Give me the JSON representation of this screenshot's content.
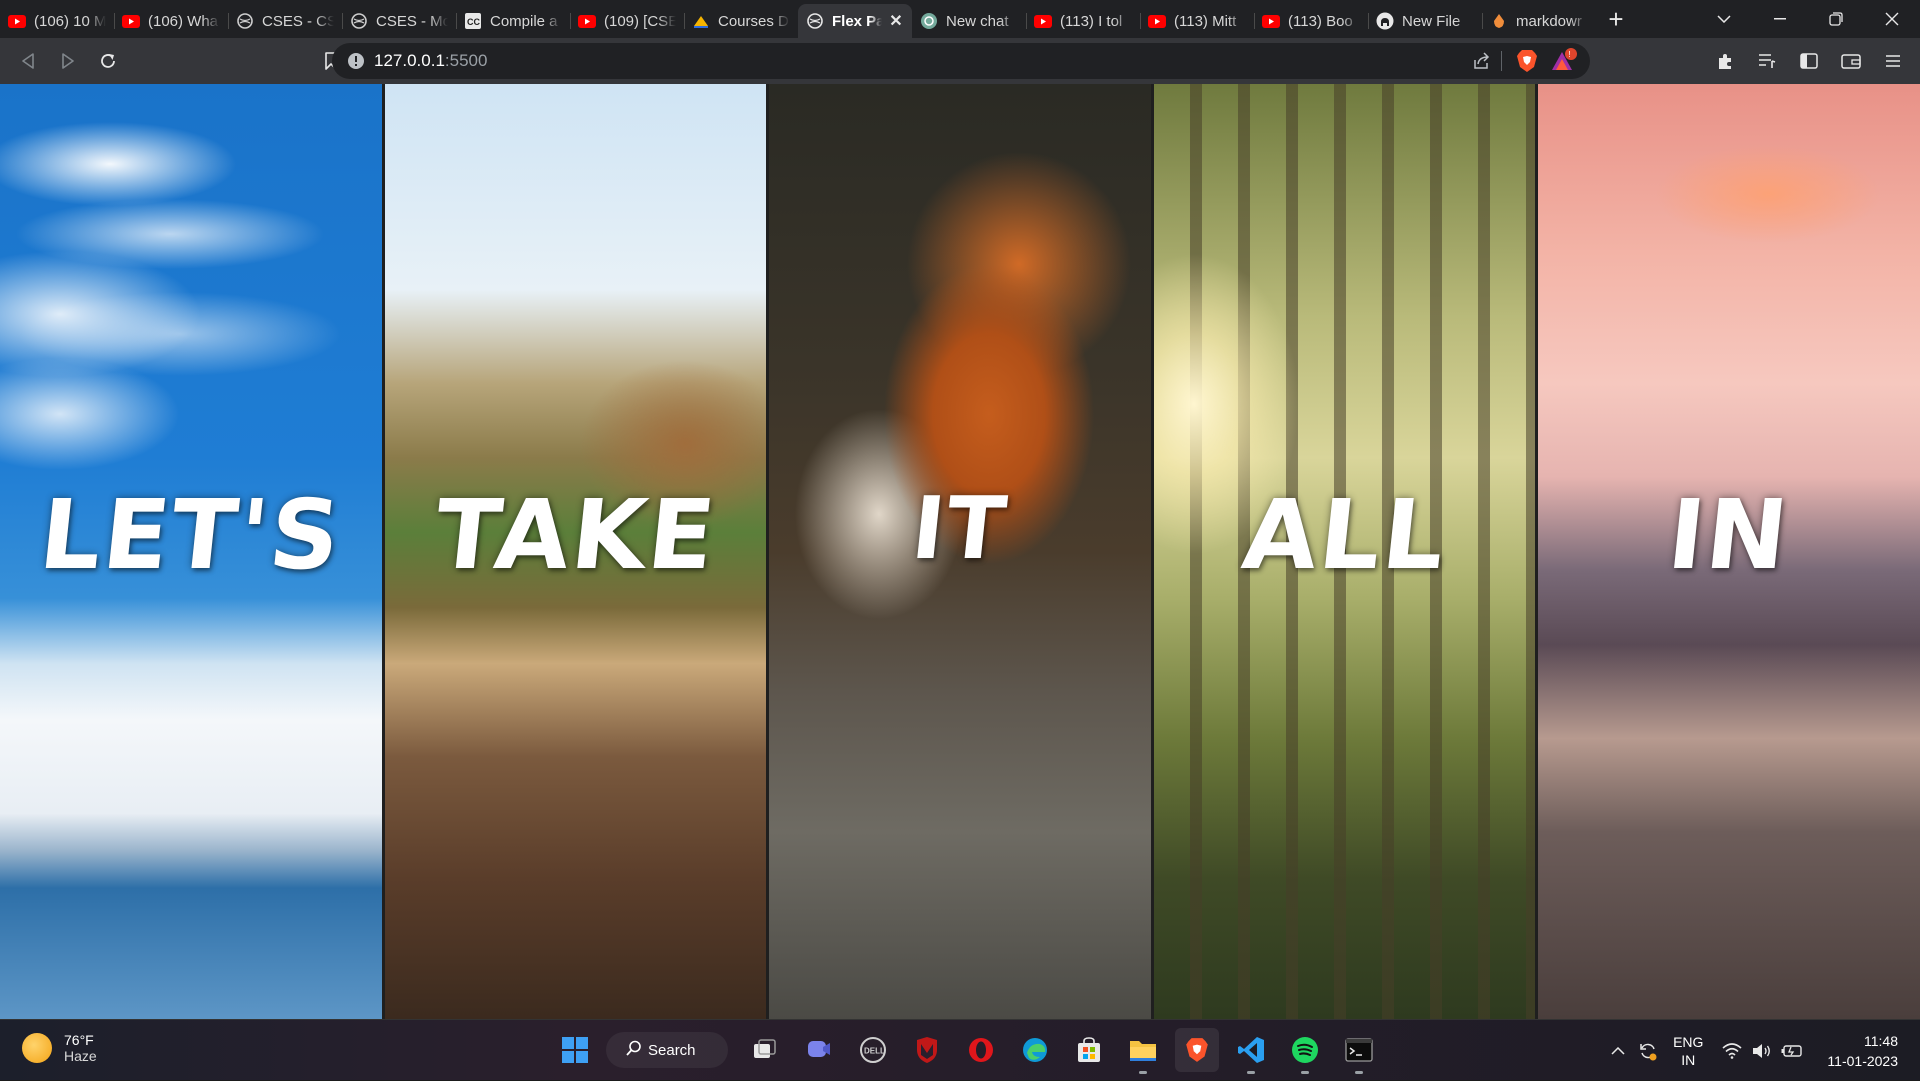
{
  "browser": {
    "tabs": [
      {
        "title": "(106) 10 M",
        "icon": "youtube-icon"
      },
      {
        "title": "(106) Wha",
        "icon": "youtube-icon"
      },
      {
        "title": "CSES - CSI",
        "icon": "globe-icon"
      },
      {
        "title": "CSES - Mo",
        "icon": "globe-icon"
      },
      {
        "title": "Compile a",
        "icon": "cc-icon"
      },
      {
        "title": "(109) [CSE",
        "icon": "youtube-icon"
      },
      {
        "title": "Courses D",
        "icon": "courses-icon"
      },
      {
        "title": "Flex Pa",
        "icon": "globe-icon",
        "active": true
      },
      {
        "title": "New chat",
        "icon": "chatgpt-icon"
      },
      {
        "title": "(113) I tol",
        "icon": "youtube-icon"
      },
      {
        "title": "(113) Mitt",
        "icon": "youtube-icon"
      },
      {
        "title": "(113) Boo",
        "icon": "youtube-icon"
      },
      {
        "title": "New File",
        "icon": "github-icon"
      },
      {
        "title": "markdowr",
        "icon": "markdown-icon"
      }
    ],
    "url_host": "127.0.0.1",
    "url_port": ":5500"
  },
  "page": {
    "panels": [
      {
        "word": "LET'S"
      },
      {
        "word": "TAKE"
      },
      {
        "word": "IT"
      },
      {
        "word": "ALL"
      },
      {
        "word": "IN"
      }
    ]
  },
  "taskbar": {
    "weather_temp": "76°F",
    "weather_desc": "Haze",
    "search_label": "Search",
    "lang_line1": "ENG",
    "lang_line2": "IN",
    "time": "11:48",
    "date": "11-01-2023"
  },
  "colors": {
    "tabbar": "#202124",
    "toolbar": "#35363a",
    "youtube_red": "#ff0000",
    "brave_orange": "#fb542b",
    "active_indicator": "#b68cff"
  }
}
